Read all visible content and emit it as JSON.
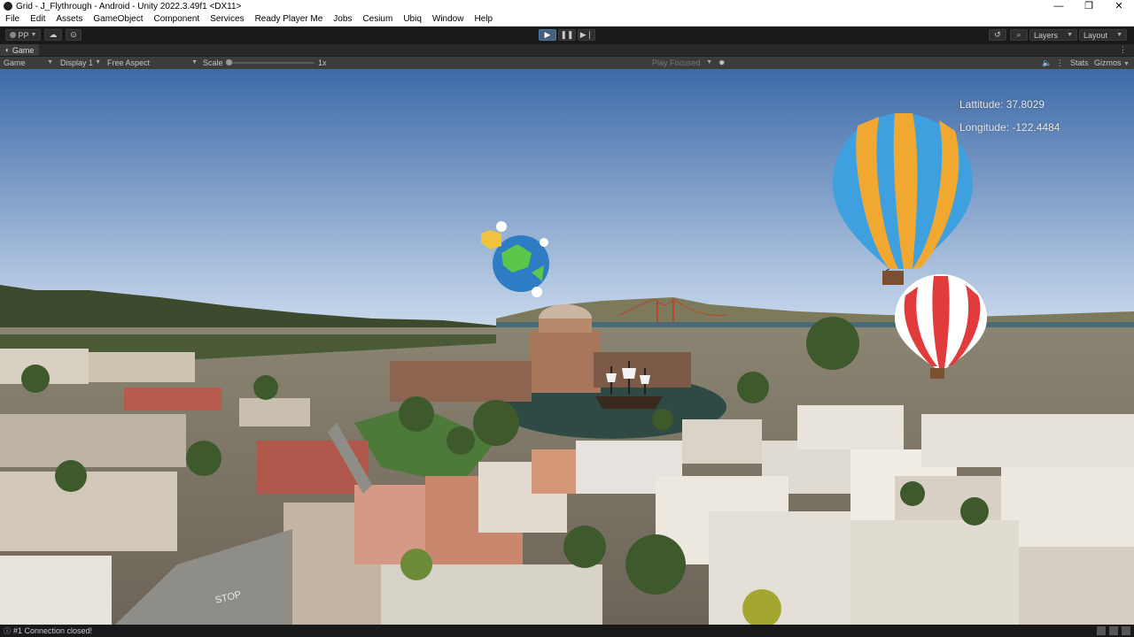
{
  "window": {
    "title": "Grid - J_Flythrough - Android - Unity 2022.3.49f1 <DX11>",
    "controls": [
      "—",
      "❐",
      "✕"
    ]
  },
  "menu": [
    "File",
    "Edit",
    "Assets",
    "GameObject",
    "Component",
    "Services",
    "Ready Player Me",
    "Jobs",
    "Cesium",
    "Ubiq",
    "Window",
    "Help"
  ],
  "toolbar": {
    "account_label": "PP",
    "layers_label": "Layers",
    "layout_label": "Layout"
  },
  "game_view": {
    "tab_label": "Game",
    "display_mode": "Game",
    "display": "Display 1",
    "aspect": "Free Aspect",
    "scale_label": "Scale",
    "scale_value": "1x",
    "play_mode": "Play Focused",
    "stats_label": "Stats",
    "gizmos_label": "Gizmos"
  },
  "hud": {
    "latitude": "Lattitude:   37.8029",
    "longitude": "Longitude: -122.4484"
  },
  "scene": {
    "road_text": "STOP",
    "sky_top": "#3d6aa8",
    "sky_horizon": "#c9d9ec",
    "water": "#4a6a78",
    "balloon_large_colors": [
      "#3fa0e0",
      "#f0a830"
    ],
    "balloon_small_colors": [
      "#e23b3b",
      "#ffffff"
    ]
  },
  "statusbar": {
    "message": "#1 Connection closed!"
  }
}
